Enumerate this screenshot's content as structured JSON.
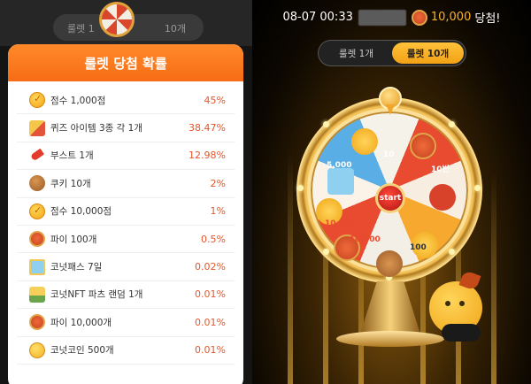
{
  "background_screen": {
    "top_text": "08-07 00:33 ███ 10,000 당첨!",
    "tab_single": "룰렛 1",
    "tab_ten": "10개"
  },
  "modal": {
    "title": "룰렛 당첨 확률",
    "rows": [
      {
        "icon": "coin-check-icon",
        "label": "점수 1,000점",
        "pct": "45%"
      },
      {
        "icon": "quiz-items-icon",
        "label": "퀴즈 아이템 3종 각 1개",
        "pct": "38.47%"
      },
      {
        "icon": "rocket-boost-icon",
        "label": "부스트 1개",
        "pct": "12.98%"
      },
      {
        "icon": "cookie-icon",
        "label": "쿠키 10개",
        "pct": "2%"
      },
      {
        "icon": "coin-check-icon",
        "label": "점수 10,000점",
        "pct": "1%"
      },
      {
        "icon": "pie-icon",
        "label": "파이 100개",
        "pct": "0.5%"
      },
      {
        "icon": "pass-icon",
        "label": "코넛패스 7일",
        "pct": "0.02%"
      },
      {
        "icon": "nft-parts-icon",
        "label": "코넛NFT 파츠 랜덤 1개",
        "pct": "0.01%"
      },
      {
        "icon": "pie-icon",
        "label": "파이 10,000개",
        "pct": "0.01%"
      },
      {
        "icon": "conut-coin-icon",
        "label": "코넛코인 500개",
        "pct": "0.01%"
      }
    ]
  },
  "roulette": {
    "winner_time": "08-07 00:33",
    "winner_amount": "10,000",
    "winner_suffix": "당첨!",
    "tabs": [
      "룰렛 1개",
      "룰렛 10개"
    ],
    "active_tab": "룰렛 10개",
    "start_label": "start",
    "segment_labels": [
      "10",
      "10번",
      "100",
      "5,000",
      "10,000",
      "10,000"
    ],
    "colors": {
      "accent": "#f7a21a",
      "modal_header": "#f7761c",
      "percent_text": "#e6552a"
    }
  }
}
